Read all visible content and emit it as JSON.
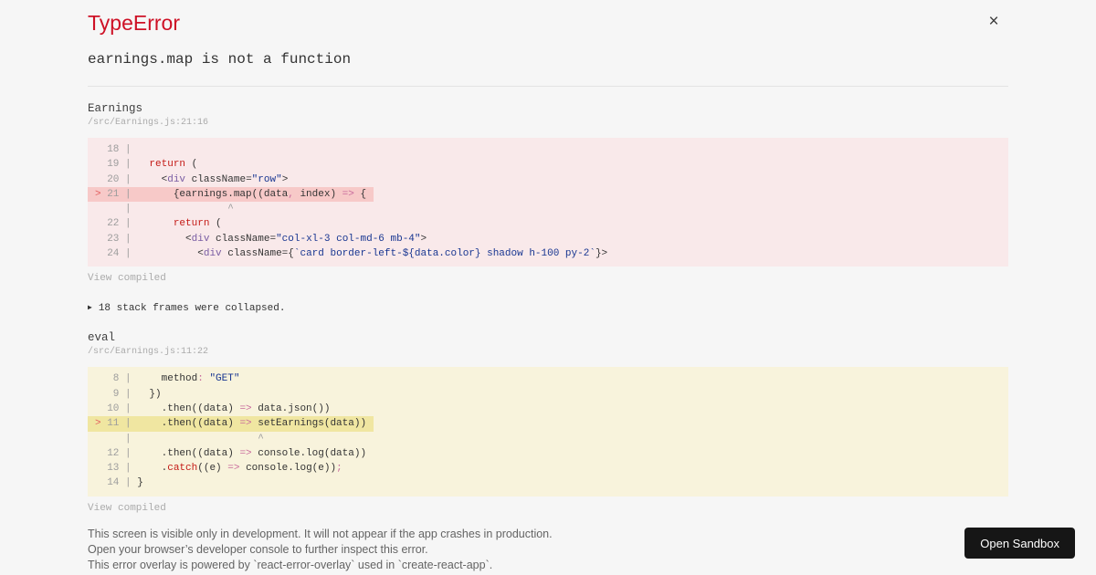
{
  "header": {
    "title": "TypeError",
    "message": "earnings.map is not a function",
    "close_icon": "×"
  },
  "colors": {
    "accent": "#ce1126",
    "keyword": "#c41a16",
    "tag": "#795da3",
    "string": "#183691",
    "operator": "#c96a9c",
    "plain": "#333333",
    "gutter": "#9d9d9d",
    "marker": "#e25d5d",
    "block_red_bg": "#f9e9ea",
    "block_red_hl": "#f7c9c8",
    "block_yellow_bg": "#f8f3dc",
    "block_yellow_hl": "#f0e6a1",
    "button_bg": "#161616"
  },
  "stack": {
    "frames": [
      {
        "fn": "Earnings",
        "path": "/src/Earnings.js:21:16",
        "view_compiled": "View compiled"
      },
      {
        "fn": "eval",
        "path": "/src/Earnings.js:11:22",
        "view_compiled": "View compiled"
      }
    ],
    "collapsed_icon": "▶",
    "collapsed_text": "18 stack frames were collapsed."
  },
  "code_blocks": [
    {
      "theme": "red",
      "lines": [
        {
          "hl": false,
          "segs": [
            [
              "  18 | ",
              "gutter"
            ]
          ]
        },
        {
          "hl": false,
          "segs": [
            [
              "  19 | ",
              "gutter"
            ],
            [
              "  ",
              "plain"
            ],
            [
              "return",
              "keyword"
            ],
            [
              " (",
              "plain"
            ]
          ]
        },
        {
          "hl": false,
          "segs": [
            [
              "  20 | ",
              "gutter"
            ],
            [
              "    <",
              "plain"
            ],
            [
              "div",
              "tag"
            ],
            [
              " className",
              "plain"
            ],
            [
              "=",
              "plain"
            ],
            [
              "\"row\"",
              "string"
            ],
            [
              ">",
              "plain"
            ]
          ]
        },
        {
          "hl": true,
          "segs": [
            [
              ">",
              "marker"
            ],
            [
              " 21 | ",
              "gutter"
            ],
            [
              "      {earnings.map((data",
              "plain"
            ],
            [
              ",",
              "operator"
            ],
            [
              " index) ",
              "plain"
            ],
            [
              "=>",
              "operator"
            ],
            [
              " {",
              "plain"
            ]
          ]
        },
        {
          "hl": false,
          "segs": [
            [
              "     | ",
              "gutter"
            ],
            [
              "               ^",
              "caret"
            ]
          ]
        },
        {
          "hl": false,
          "segs": [
            [
              "  22 | ",
              "gutter"
            ],
            [
              "      ",
              "plain"
            ],
            [
              "return",
              "keyword"
            ],
            [
              " (",
              "plain"
            ]
          ]
        },
        {
          "hl": false,
          "segs": [
            [
              "  23 | ",
              "gutter"
            ],
            [
              "        <",
              "plain"
            ],
            [
              "div",
              "tag"
            ],
            [
              " className",
              "plain"
            ],
            [
              "=",
              "plain"
            ],
            [
              "\"col-xl-3 col-md-6 mb-4\"",
              "string"
            ],
            [
              ">",
              "plain"
            ]
          ]
        },
        {
          "hl": false,
          "segs": [
            [
              "  24 | ",
              "gutter"
            ],
            [
              "          <",
              "plain"
            ],
            [
              "div",
              "tag"
            ],
            [
              " className",
              "plain"
            ],
            [
              "={",
              "plain"
            ],
            [
              "`card border-left-${data.color} shadow h-100 py-2`",
              "string"
            ],
            [
              "}>",
              "plain"
            ]
          ]
        }
      ]
    },
    {
      "theme": "yellow",
      "lines": [
        {
          "hl": false,
          "segs": [
            [
              "   8 | ",
              "gutter"
            ],
            [
              "    method",
              "plain"
            ],
            [
              ":",
              "operator"
            ],
            [
              " ",
              "plain"
            ],
            [
              "\"GET\"",
              "string"
            ]
          ]
        },
        {
          "hl": false,
          "segs": [
            [
              "   9 | ",
              "gutter"
            ],
            [
              "  })",
              "plain"
            ]
          ]
        },
        {
          "hl": false,
          "segs": [
            [
              "  10 | ",
              "gutter"
            ],
            [
              "    .then((data) ",
              "plain"
            ],
            [
              "=>",
              "operator"
            ],
            [
              " data.json())",
              "plain"
            ]
          ]
        },
        {
          "hl": true,
          "segs": [
            [
              ">",
              "marker"
            ],
            [
              " 11 | ",
              "gutter"
            ],
            [
              "    .then((data) ",
              "plain"
            ],
            [
              "=>",
              "operator"
            ],
            [
              " setEarnings(data))",
              "plain"
            ]
          ]
        },
        {
          "hl": false,
          "segs": [
            [
              "     | ",
              "gutter"
            ],
            [
              "                    ^",
              "caret"
            ]
          ]
        },
        {
          "hl": false,
          "segs": [
            [
              "  12 | ",
              "gutter"
            ],
            [
              "    .then((data) ",
              "plain"
            ],
            [
              "=>",
              "operator"
            ],
            [
              " console.log(data))",
              "plain"
            ]
          ]
        },
        {
          "hl": false,
          "segs": [
            [
              "  13 | ",
              "gutter"
            ],
            [
              "    .",
              "plain"
            ],
            [
              "catch",
              "keyword"
            ],
            [
              "((e) ",
              "plain"
            ],
            [
              "=>",
              "operator"
            ],
            [
              " console.log(e))",
              "plain"
            ],
            [
              ";",
              "operator"
            ]
          ]
        },
        {
          "hl": false,
          "segs": [
            [
              "  14 | ",
              "gutter"
            ],
            [
              "}",
              "plain"
            ]
          ]
        }
      ]
    }
  ],
  "footer": {
    "lines": [
      "This screen is visible only in development. It will not appear if the app crashes in production.",
      "Open your browser’s developer console to further inspect this error.",
      "This error overlay is powered by `react-error-overlay` used in `create-react-app`."
    ],
    "open_sandbox_label": "Open Sandbox"
  }
}
